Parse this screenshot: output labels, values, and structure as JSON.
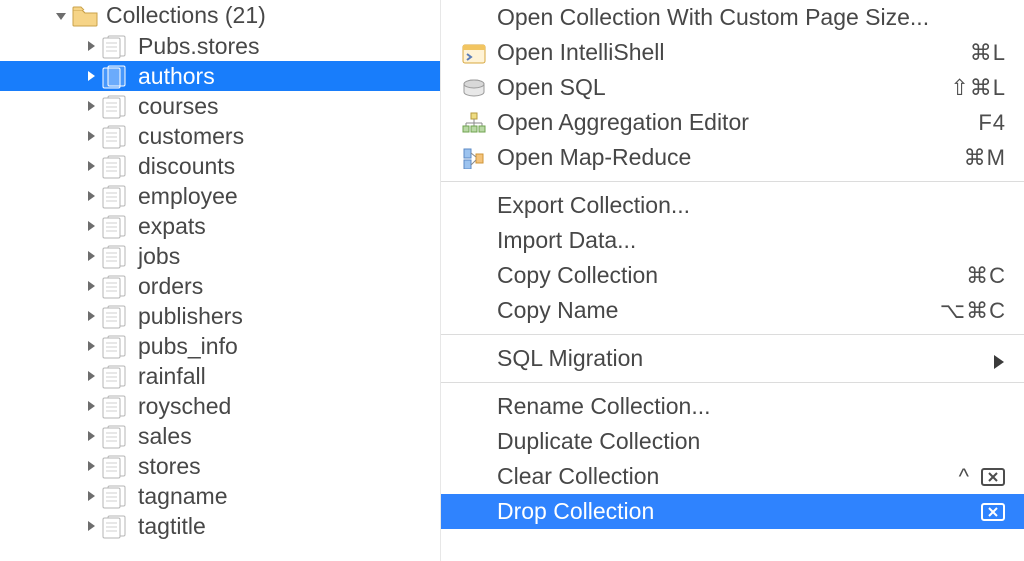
{
  "tree": {
    "folder": {
      "label": "Collections",
      "count": "(21)"
    },
    "items": [
      {
        "label": "Pubs.stores",
        "selected": false
      },
      {
        "label": "authors",
        "selected": true
      },
      {
        "label": "courses",
        "selected": false
      },
      {
        "label": "customers",
        "selected": false
      },
      {
        "label": "discounts",
        "selected": false
      },
      {
        "label": "employee",
        "selected": false
      },
      {
        "label": "expats",
        "selected": false
      },
      {
        "label": "jobs",
        "selected": false
      },
      {
        "label": "orders",
        "selected": false
      },
      {
        "label": "publishers",
        "selected": false
      },
      {
        "label": "pubs_info",
        "selected": false
      },
      {
        "label": "rainfall",
        "selected": false
      },
      {
        "label": "roysched",
        "selected": false
      },
      {
        "label": "sales",
        "selected": false
      },
      {
        "label": "stores",
        "selected": false
      },
      {
        "label": "tagname",
        "selected": false
      },
      {
        "label": "tagtitle",
        "selected": false
      }
    ]
  },
  "menu": {
    "groups": [
      [
        {
          "label": "Open Collection With Custom Page Size...",
          "icon": null,
          "shortcut": "",
          "submenu": false,
          "highlighted": false
        },
        {
          "label": "Open IntelliShell",
          "icon": "shell",
          "shortcut": "⌘L",
          "submenu": false,
          "highlighted": false
        },
        {
          "label": "Open SQL",
          "icon": "sql",
          "shortcut": "⇧⌘L",
          "submenu": false,
          "highlighted": false
        },
        {
          "label": "Open Aggregation Editor",
          "icon": "aggregation",
          "shortcut": "F4",
          "submenu": false,
          "highlighted": false
        },
        {
          "label": "Open Map-Reduce",
          "icon": "mapreduce",
          "shortcut": "⌘M",
          "submenu": false,
          "highlighted": false
        }
      ],
      [
        {
          "label": "Export Collection...",
          "icon": null,
          "shortcut": "",
          "submenu": false,
          "highlighted": false
        },
        {
          "label": "Import Data...",
          "icon": null,
          "shortcut": "",
          "submenu": false,
          "highlighted": false
        },
        {
          "label": "Copy Collection",
          "icon": null,
          "shortcut": "⌘C",
          "submenu": false,
          "highlighted": false
        },
        {
          "label": "Copy Name",
          "icon": null,
          "shortcut": "⌥⌘C",
          "submenu": false,
          "highlighted": false
        }
      ],
      [
        {
          "label": "SQL Migration",
          "icon": null,
          "shortcut": "",
          "submenu": true,
          "highlighted": false
        }
      ],
      [
        {
          "label": "Rename Collection...",
          "icon": null,
          "shortcut": "",
          "submenu": false,
          "highlighted": false
        },
        {
          "label": "Duplicate Collection",
          "icon": null,
          "shortcut": "",
          "submenu": false,
          "highlighted": false
        },
        {
          "label": "Clear Collection",
          "icon": null,
          "shortcut": "^⌫",
          "submenu": false,
          "highlighted": false,
          "trailIcon": "delete"
        },
        {
          "label": "Drop Collection",
          "icon": null,
          "shortcut": "⌫",
          "submenu": false,
          "highlighted": true,
          "trailIcon": "delete"
        }
      ]
    ]
  }
}
